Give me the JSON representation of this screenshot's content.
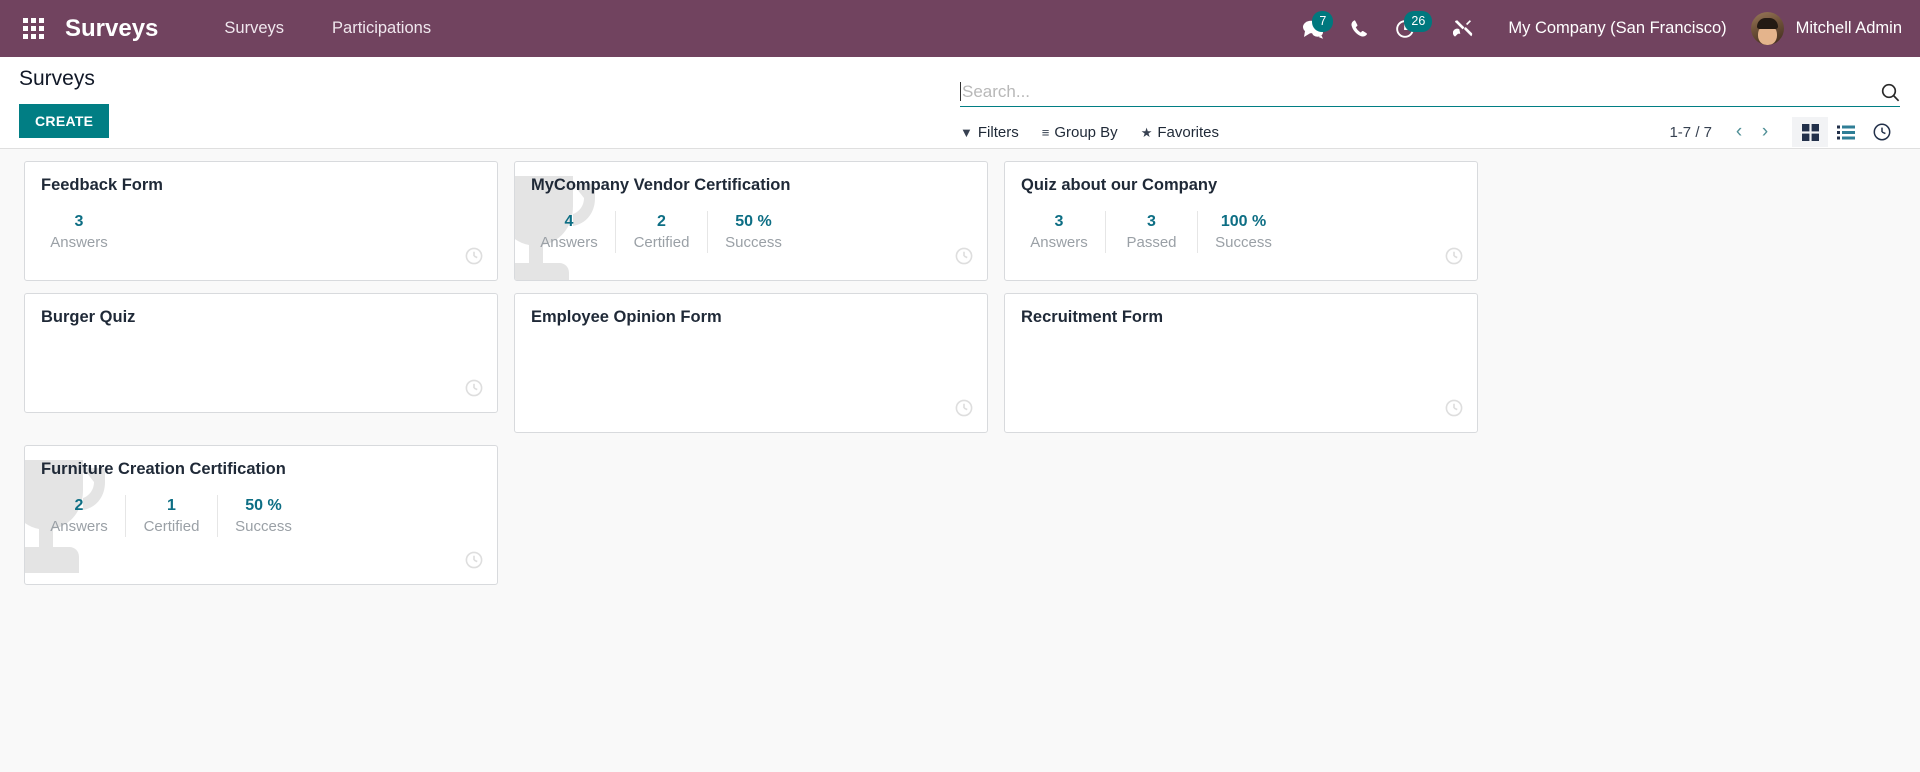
{
  "navbar": {
    "apps_icon": "apps-grid-icon",
    "brand": "Surveys",
    "menu": [
      {
        "label": "Surveys"
      },
      {
        "label": "Participations"
      }
    ],
    "sysicons": [
      {
        "name": "messages-icon",
        "badge": "7"
      },
      {
        "name": "phone-icon",
        "badge": ""
      },
      {
        "name": "activities-clock-icon",
        "badge": "26"
      },
      {
        "name": "tools-icon",
        "badge": ""
      }
    ],
    "company": "My Company (San Francisco)",
    "user": "Mitchell Admin",
    "bg_color": "#71435f",
    "badge_color": "#00787e"
  },
  "control_panel": {
    "title": "Surveys",
    "create_label": "CREATE",
    "create_color": "#017e84",
    "search": {
      "value": "",
      "placeholder": "Search...",
      "icon": "search-icon"
    },
    "filters": [
      {
        "name": "filters",
        "glyph": "▼",
        "label": "Filters"
      },
      {
        "name": "group-by",
        "glyph": "≡",
        "label": "Group By"
      },
      {
        "name": "favorites",
        "glyph": "★",
        "label": "Favorites"
      }
    ],
    "pager": {
      "count": "1-7 / 7",
      "prev": "‹",
      "next": "›"
    },
    "views": [
      {
        "name": "kanban-view",
        "active": true
      },
      {
        "name": "list-view",
        "active": false
      },
      {
        "name": "activity-view",
        "active": false
      }
    ]
  },
  "kanban": {
    "cards": [
      {
        "title": "Feedback Form",
        "trophy": false,
        "tall": false,
        "stats": [
          {
            "value": "3",
            "label": "Answers"
          }
        ]
      },
      {
        "title": "MyCompany Vendor Certification",
        "trophy": true,
        "tall": false,
        "stats": [
          {
            "value": "4",
            "label": "Answers"
          },
          {
            "value": "2",
            "label": "Certified"
          },
          {
            "value": "50 %",
            "label": "Success"
          }
        ]
      },
      {
        "title": "Quiz about our Company",
        "trophy": false,
        "tall": false,
        "stats": [
          {
            "value": "3",
            "label": "Answers"
          },
          {
            "value": "3",
            "label": "Passed"
          },
          {
            "value": "100 %",
            "label": "Success"
          }
        ]
      },
      {
        "title": "Burger Quiz",
        "trophy": false,
        "tall": false,
        "stats": []
      },
      {
        "title": "Employee Opinion Form",
        "trophy": false,
        "tall": true,
        "stats": []
      },
      {
        "title": "Recruitment Form",
        "trophy": false,
        "tall": true,
        "stats": []
      },
      {
        "title": "Furniture Creation Certification",
        "trophy": true,
        "tall": true,
        "stats": [
          {
            "value": "2",
            "label": "Answers"
          },
          {
            "value": "1",
            "label": "Certified"
          },
          {
            "value": "50 %",
            "label": "Success"
          }
        ]
      }
    ]
  }
}
